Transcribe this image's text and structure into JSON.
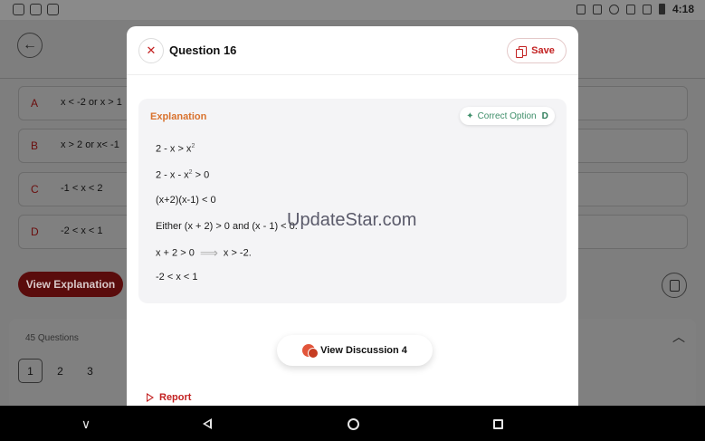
{
  "status_bar": {
    "time": "4:18",
    "left_icons": [
      "youtube-icon",
      "gallery-icon",
      "app-icon"
    ],
    "right_icons": [
      "cast-icon",
      "bluetooth-icon",
      "do-not-disturb-icon",
      "wifi-icon",
      "cellular-off-icon",
      "battery-icon"
    ]
  },
  "background": {
    "options": [
      {
        "letter": "A",
        "text": "x < -2 or x > 1"
      },
      {
        "letter": "B",
        "text": "x > 2 or x< -1"
      },
      {
        "letter": "C",
        "text": "-1 < x < 2"
      },
      {
        "letter": "D",
        "text": "-2 < x < 1"
      }
    ],
    "view_explanation_label": "View Explanation",
    "questions_count_label": "45 Questions",
    "question_numbers": [
      "1",
      "2",
      "3"
    ],
    "active_question": "1"
  },
  "modal": {
    "close_glyph": "✕",
    "title": "Question 16",
    "save_label": "Save",
    "explanation_label": "Explanation",
    "correct_option_label": "Correct Option",
    "correct_option_value": "D",
    "lines": {
      "l1_pre": "2 - x > x",
      "l1_sup": "2",
      "l2_pre": "2 - x - x",
      "l2_sup": "2",
      "l2_post": " > 0",
      "l3": "(x+2)(x-1) < 0",
      "l4": "Either (x + 2) > 0 and (x - 1) < 0.",
      "l5_pre": "x + 2 > 0",
      "l5_post": "x > -2.",
      "l6": "-2 < x < 1"
    },
    "watermark": "UpdateStar.com",
    "view_discussion_label": "View Discussion 4",
    "report_label": "Report"
  },
  "colors": {
    "accent_red": "#c32222",
    "explanation_orange": "#d9722e",
    "correct_green": "#3f8f6a"
  }
}
